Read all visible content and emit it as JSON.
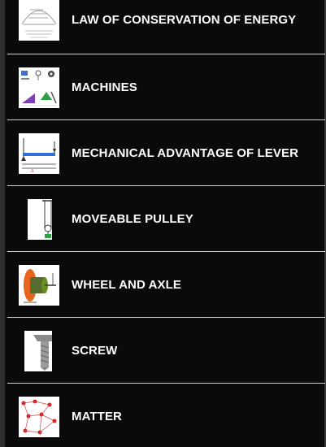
{
  "topics": [
    {
      "label": "LAW OF CONSERVATION OF ENERGY",
      "icon": "energy-diagram-icon"
    },
    {
      "label": "MACHINES",
      "icon": "simple-machines-icon"
    },
    {
      "label": "MECHANICAL ADVANTAGE OF LEVER",
      "icon": "lever-icon"
    },
    {
      "label": "MOVEABLE PULLEY",
      "icon": "pulley-icon"
    },
    {
      "label": "WHEEL AND AXLE",
      "icon": "wheel-axle-icon"
    },
    {
      "label": "SCREW",
      "icon": "screw-icon"
    },
    {
      "label": "MATTER",
      "icon": "molecules-icon"
    }
  ],
  "colors": {
    "background": "#0a0a0a",
    "divider": "#cfcfcf",
    "label": "#ffffff"
  }
}
